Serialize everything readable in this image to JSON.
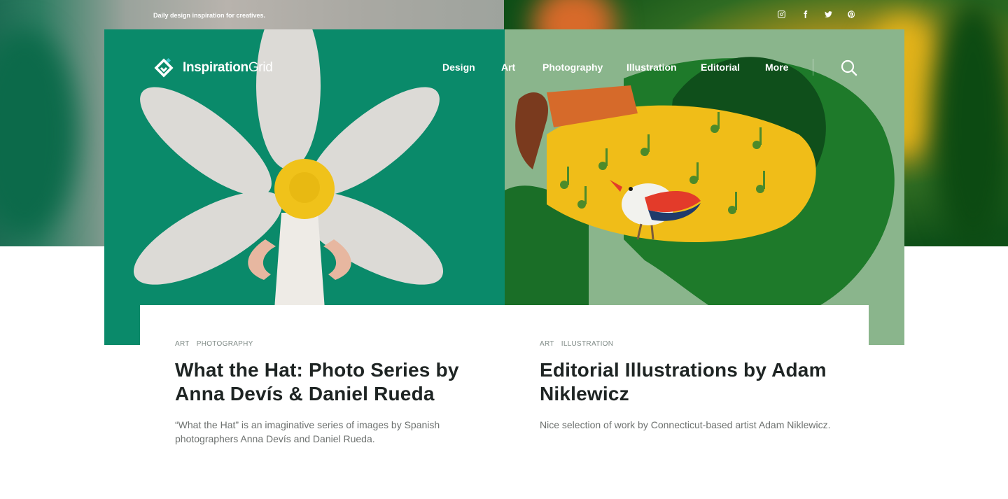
{
  "header": {
    "tagline": "Daily design inspiration for creatives.",
    "social": [
      "instagram-icon",
      "facebook-icon",
      "twitter-icon",
      "pinterest-icon"
    ]
  },
  "brand": {
    "name_bold": "Inspiration",
    "name_light": "Grid"
  },
  "nav": {
    "items": [
      "Design",
      "Art",
      "Photography",
      "Illustration",
      "Editorial",
      "More"
    ],
    "search_icon": "search-icon"
  },
  "posts": [
    {
      "tags": [
        "ART",
        "PHOTOGRAPHY"
      ],
      "title": "What the Hat: Photo Series by Anna Devís & Daniel Rueda",
      "excerpt": "“What the Hat” is an imaginative series of images by Spanish photographers Anna Devís and Daniel Rueda."
    },
    {
      "tags": [
        "ART",
        "ILLUSTRATION"
      ],
      "title": "Editorial Illustrations by Adam Niklewicz",
      "excerpt": "Nice selection of work by Connecticut-based artist Adam Niklewicz."
    }
  ],
  "colors": {
    "left_panel": "#0a8a6a",
    "right_panel": "#8ab58c",
    "title_text": "#1e2423",
    "tag_text": "#7f8a86"
  }
}
